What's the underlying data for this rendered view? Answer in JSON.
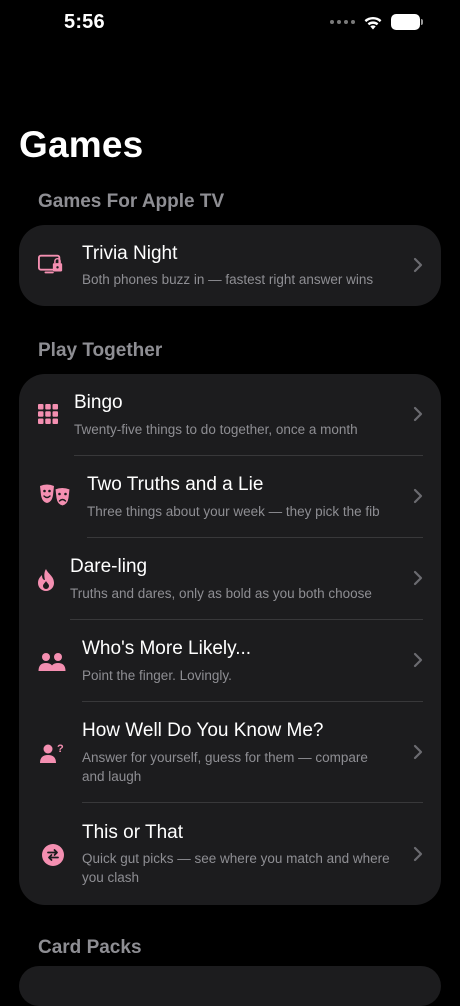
{
  "status_bar": {
    "time": "5:56"
  },
  "page": {
    "title": "Games"
  },
  "sections": [
    {
      "header": "Games For Apple TV",
      "items": [
        {
          "icon": "tv-lock-icon",
          "title": "Trivia Night",
          "subtitle": "Both phones buzz in — fastest right answer wins"
        }
      ]
    },
    {
      "header": "Play Together",
      "items": [
        {
          "icon": "grid-icon",
          "title": "Bingo",
          "subtitle": "Twenty-five things to do together, once a month"
        },
        {
          "icon": "theater-masks-icon",
          "title": "Two Truths and a Lie",
          "subtitle": "Three things about your week — they pick the fib"
        },
        {
          "icon": "flame-icon",
          "title": "Dare-ling",
          "subtitle": "Truths and dares, only as bold as you both choose"
        },
        {
          "icon": "people-icon",
          "title": "Who's More Likely...",
          "subtitle": "Point the finger. Lovingly."
        },
        {
          "icon": "person-question-icon",
          "title": "How Well Do You Know Me?",
          "subtitle": "Answer for yourself, guess for them — compare and laugh"
        },
        {
          "icon": "swap-arrows-icon",
          "title": "This or That",
          "subtitle": "Quick gut picks — see where you match and where you clash"
        }
      ]
    },
    {
      "header": "Card Packs",
      "items": []
    }
  ],
  "colors": {
    "accent": "#f48fb1",
    "background": "#000000",
    "card": "#1c1c1e",
    "secondary_text": "#8e8e93",
    "separator": "#38383a"
  }
}
